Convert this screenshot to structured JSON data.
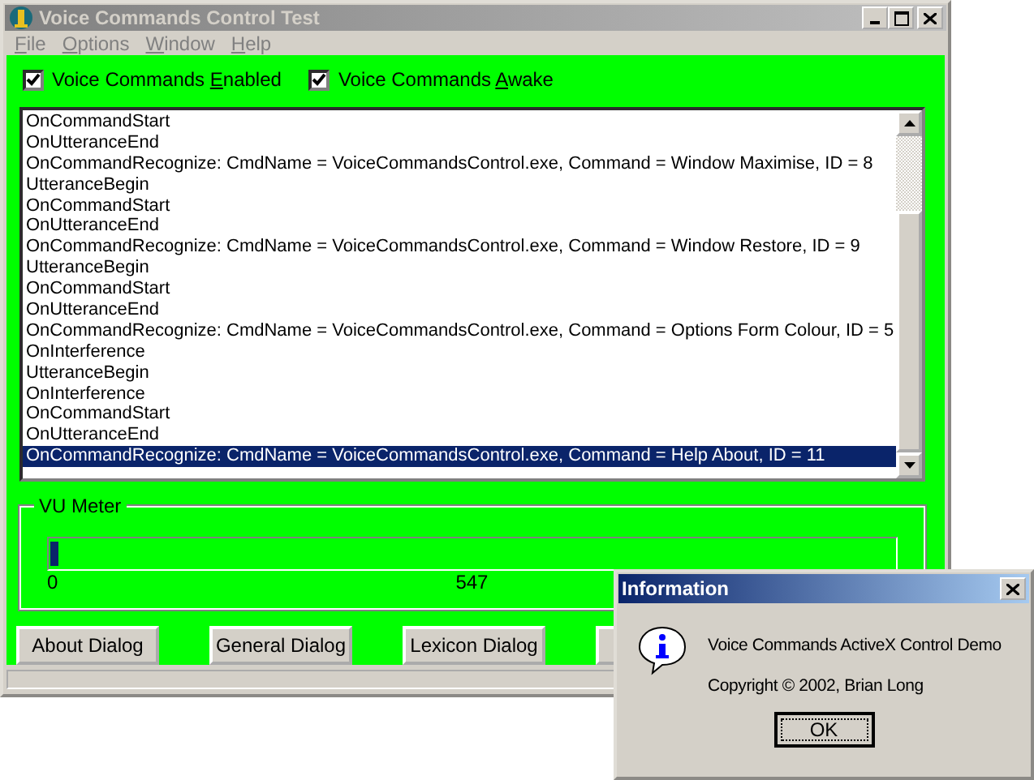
{
  "window": {
    "title": "Voice Commands Control Test",
    "active": false
  },
  "menu": [
    {
      "key": "F",
      "rest": "ile"
    },
    {
      "key": "O",
      "rest": "ptions"
    },
    {
      "key": "W",
      "rest": "indow"
    },
    {
      "key": "H",
      "rest": "elp"
    }
  ],
  "checkboxes": [
    {
      "parts": [
        "Voice Commands ",
        "E",
        "nabled"
      ],
      "checked": true
    },
    {
      "parts": [
        "Voice Commands ",
        "A",
        "wake"
      ],
      "checked": true
    }
  ],
  "events": [
    {
      "text": "OnCommandStart",
      "selected": false
    },
    {
      "text": "OnUtteranceEnd",
      "selected": false
    },
    {
      "text": "OnCommandRecognize: CmdName = VoiceCommandsControl.exe, Command = Window Maximise, ID = 8",
      "selected": false
    },
    {
      "text": "UtteranceBegin",
      "selected": false
    },
    {
      "text": "OnCommandStart",
      "selected": false
    },
    {
      "text": "OnUtteranceEnd",
      "selected": false
    },
    {
      "text": "OnCommandRecognize: CmdName = VoiceCommandsControl.exe, Command = Window Restore, ID = 9",
      "selected": false
    },
    {
      "text": "UtteranceBegin",
      "selected": false
    },
    {
      "text": "OnCommandStart",
      "selected": false
    },
    {
      "text": "OnUtteranceEnd",
      "selected": false
    },
    {
      "text": "OnCommandRecognize: CmdName = VoiceCommandsControl.exe, Command = Options Form Colour, ID = 5",
      "selected": false
    },
    {
      "text": "OnInterference",
      "selected": false
    },
    {
      "text": "UtteranceBegin",
      "selected": false
    },
    {
      "text": "OnInterference",
      "selected": false
    },
    {
      "text": "OnCommandStart",
      "selected": false
    },
    {
      "text": "OnUtteranceEnd",
      "selected": false
    },
    {
      "text": "OnCommandRecognize: CmdName = VoiceCommandsControl.exe, Command = Help About, ID = 11",
      "selected": true
    }
  ],
  "vu_meter": {
    "title": "VU Meter",
    "level": 0.01,
    "min_label": "0",
    "mid_label": "547"
  },
  "buttons": [
    "About Dialog",
    "General Dialog",
    "Lexicon Dialog"
  ],
  "dialog": {
    "title": "Information",
    "message": "Voice Commands ActiveX Control Demo",
    "copyright": "Copyright © 2002, Brian Long",
    "ok": "OK"
  }
}
